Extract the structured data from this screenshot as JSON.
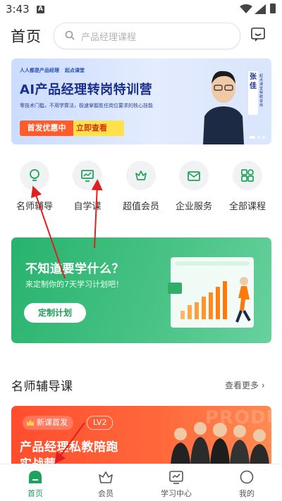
{
  "status_bar": {
    "time": "3:43",
    "notification_icon": "A"
  },
  "header": {
    "title": "首页",
    "search_placeholder": "产品经理课程",
    "message_icon": "message-icon"
  },
  "banner": {
    "logos": [
      "人人都是产品经理",
      "起点课堂"
    ],
    "title": "AI产品经理转岗特训营",
    "subtitle": "零技术门槛，不用学算法，极速掌握胜任岗位要求的核心技能",
    "cta_left": "首发优惠中",
    "cta_right": "立即查看",
    "speaker_name": "张佳",
    "speaker_desc": "起点课堂特聘讲师",
    "slide_count": 3
  },
  "nav": [
    {
      "label": "名师辅导",
      "icon": "bulb-icon"
    },
    {
      "label": "自学课",
      "icon": "presentation-icon"
    },
    {
      "label": "超值会员",
      "icon": "vip-crown-icon"
    },
    {
      "label": "企业服务",
      "icon": "envelope-icon"
    },
    {
      "label": "全部课程",
      "icon": "grid-icon"
    }
  ],
  "plan_card": {
    "title": "不知道要学什么？",
    "subtitle": "来定制你的7天学习计划吧！",
    "button": "定制计划"
  },
  "section": {
    "title": "名师辅导课",
    "more": "查看更多"
  },
  "course": {
    "badge": "新课首发",
    "level": "LV2",
    "name_line1": "产品经理私教陪跑",
    "name_line2": "实战营",
    "watermark": "PRODUC"
  },
  "tabbar": [
    {
      "label": "首页",
      "icon": "home-icon",
      "active": true
    },
    {
      "label": "会员",
      "icon": "member-crown-icon",
      "active": false
    },
    {
      "label": "学习中心",
      "icon": "study-center-icon",
      "active": false
    },
    {
      "label": "我的",
      "icon": "profile-icon",
      "active": false
    }
  ],
  "colors": {
    "accent": "#1fa25c",
    "card_green": "#3cbd7b",
    "course_orange": "#ff5a34",
    "banner_blue": "#1a2e8c"
  }
}
